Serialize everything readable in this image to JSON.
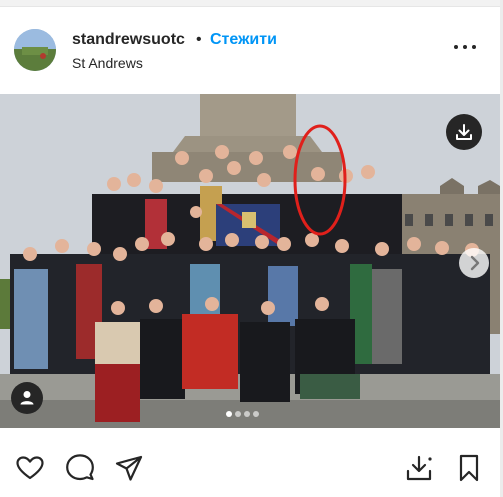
{
  "post": {
    "username": "standrewsuotc",
    "separator": "•",
    "follow_label": "Стежити",
    "location": "St Andrews"
  },
  "icons": {
    "more": "more-horizontal-icon",
    "download": "download-icon",
    "next": "chevron-right-icon",
    "tagged_user": "user-icon",
    "like": "heart-icon",
    "comment": "comment-icon",
    "share": "send-icon",
    "save_download": "download-icon",
    "bookmark": "bookmark-icon"
  },
  "carousel": {
    "slides": 4,
    "active_index": 0
  },
  "colors": {
    "accent": "#0095f6",
    "annotation_circle": "#e0201b",
    "text": "#262626"
  }
}
